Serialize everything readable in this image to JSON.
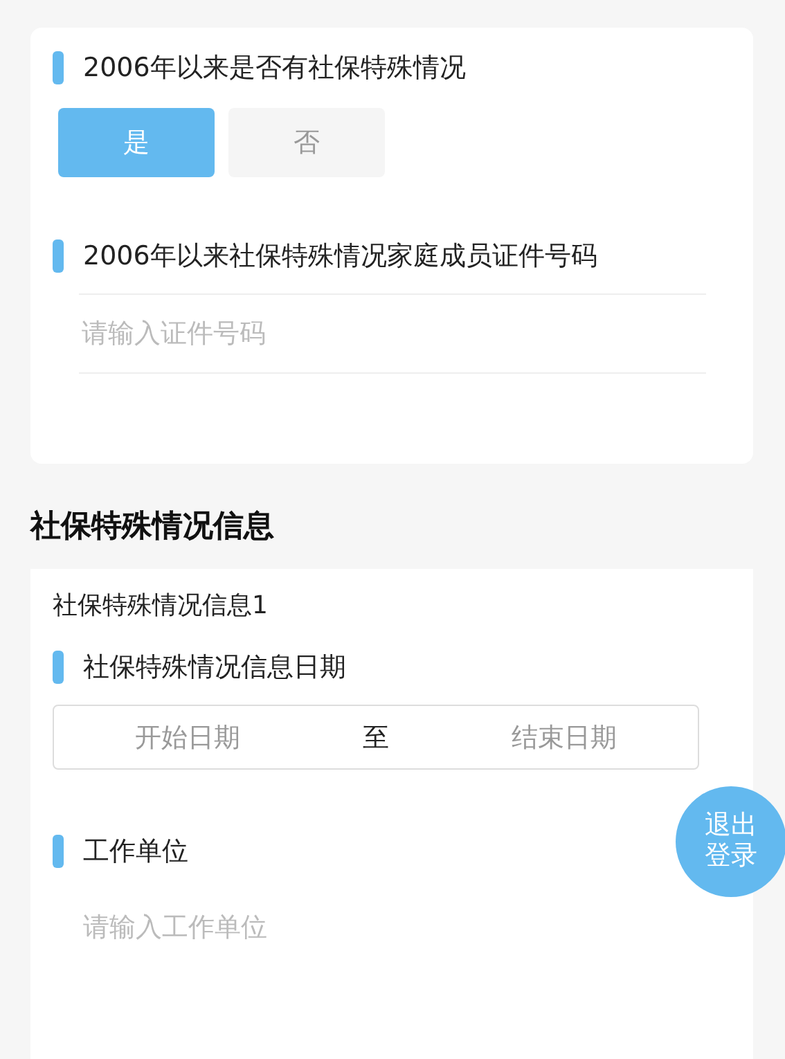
{
  "special_case_card": {
    "question": {
      "label": "2006年以来是否有社保特殊情况",
      "options": [
        {
          "label": "是",
          "selected": true
        },
        {
          "label": "否",
          "selected": false
        }
      ]
    },
    "id_field": {
      "label": "2006年以来社保特殊情况家庭成员证件号码",
      "placeholder": "请输入证件号码"
    }
  },
  "section": {
    "title": "社保特殊情况信息",
    "entries": [
      {
        "title": "社保特殊情况信息1",
        "date_label": "社保特殊情况信息日期",
        "start_placeholder": "开始日期",
        "separator": "至",
        "end_placeholder": "结束日期",
        "employer_label": "工作单位",
        "employer_placeholder": "请输入工作单位"
      }
    ]
  },
  "logout_button": "退出登录"
}
